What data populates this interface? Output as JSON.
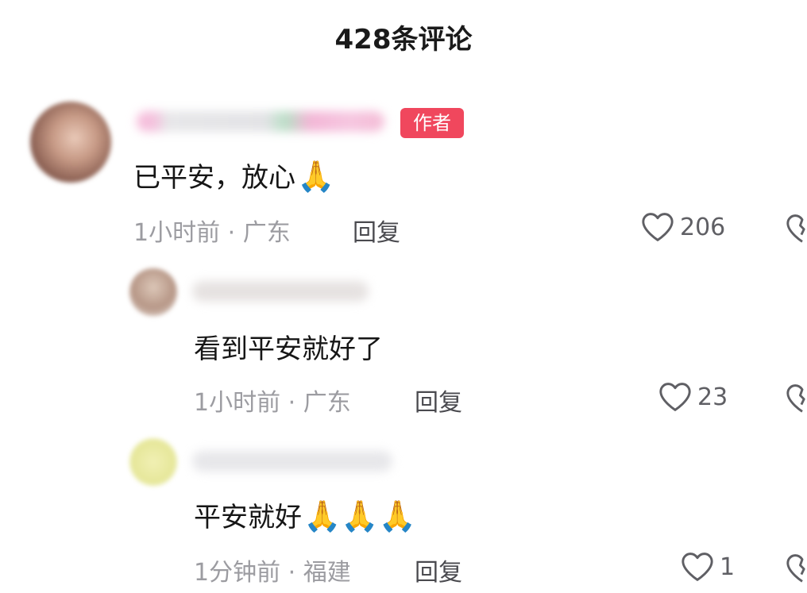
{
  "header": {
    "title": "428条评论"
  },
  "comments": [
    {
      "author_badge": "作者",
      "text": "已平安，放心",
      "emoji": "🙏",
      "meta": "1小时前 · 广东",
      "reply_label": "回复",
      "likes": "206"
    }
  ],
  "replies": [
    {
      "text": "看到平安就好了",
      "meta": "1小时前 · 广东",
      "reply_label": "回复",
      "likes": "23"
    },
    {
      "text": "平安就好",
      "emoji": "🙏🙏🙏",
      "meta": "1分钟前 · 福建",
      "reply_label": "回复",
      "likes": "1"
    }
  ],
  "icons": {
    "like": "heart-outline-icon",
    "dislike": "broken-heart-icon"
  },
  "colors": {
    "author_badge": "#f0475d",
    "meta_text": "#9c9ca1"
  }
}
